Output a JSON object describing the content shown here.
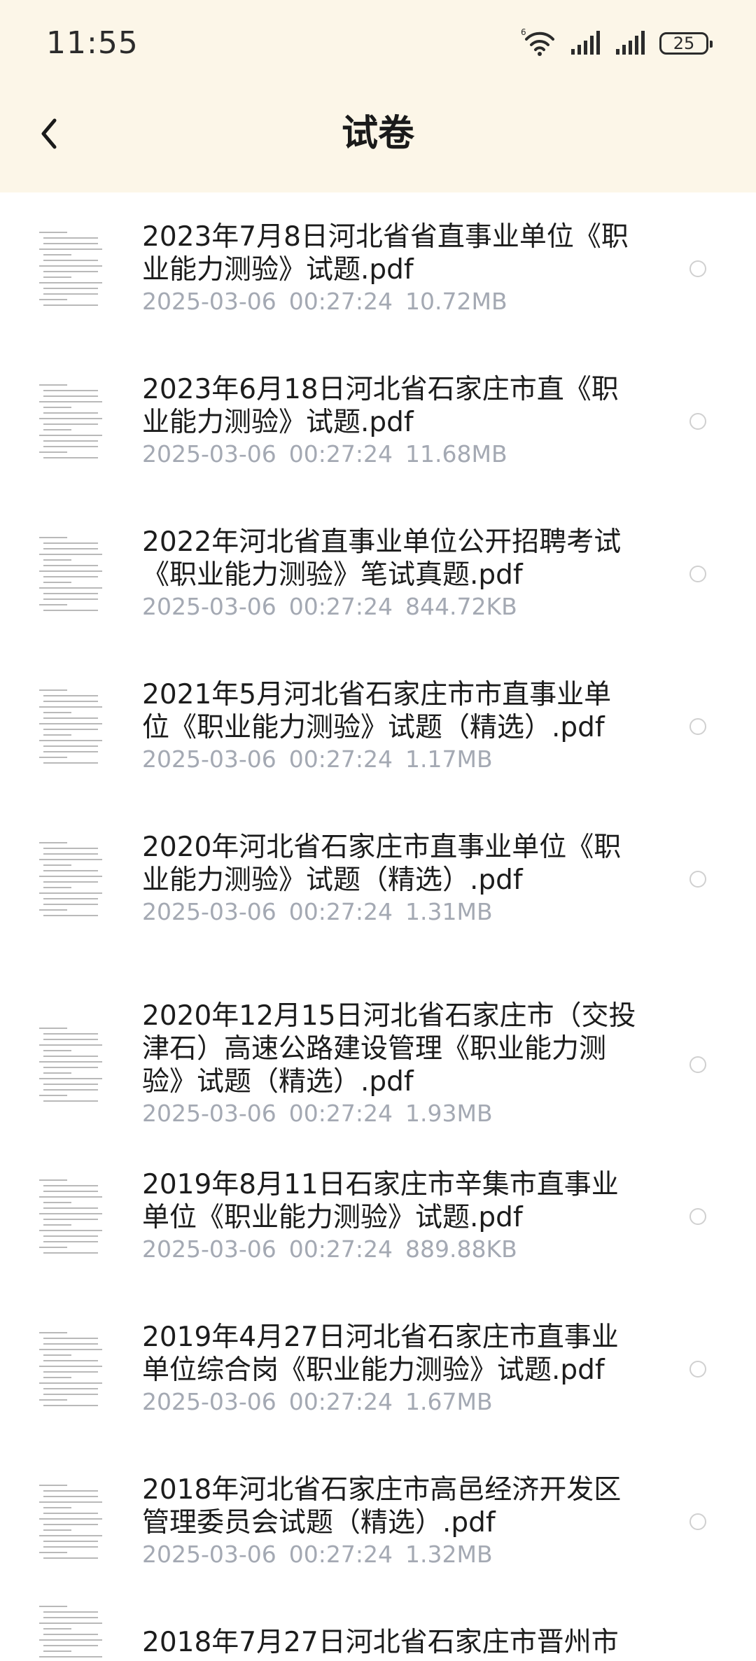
{
  "status_bar": {
    "time": "11:55",
    "wifi_icon": "wifi-6-icon",
    "signal_icons": [
      "signal-icon",
      "signal-icon"
    ],
    "battery": "25"
  },
  "header": {
    "back_icon": "chevron-left-icon",
    "title": "试卷"
  },
  "files": [
    {
      "name": "2023年7月8日河北省省直事业单位《职\n业能力测验》试题.pdf",
      "date": "2025-03-06",
      "time": "00:27:24",
      "size": "10.72MB"
    },
    {
      "name": "2023年6月18日河北省石家庄市直《职\n业能力测验》试题.pdf",
      "date": "2025-03-06",
      "time": "00:27:24",
      "size": "11.68MB"
    },
    {
      "name": "2022年河北省直事业单位公开招聘考试\n《职业能力测验》笔试真题.pdf",
      "date": "2025-03-06",
      "time": "00:27:24",
      "size": "844.72KB"
    },
    {
      "name": "2021年5月河北省石家庄市市直事业单\n位《职业能力测验》试题（精选）.pdf",
      "date": "2025-03-06",
      "time": "00:27:24",
      "size": "1.17MB"
    },
    {
      "name": "2020年河北省石家庄市直事业单位《职\n业能力测验》试题（精选）.pdf",
      "date": "2025-03-06",
      "time": "00:27:24",
      "size": "1.31MB"
    },
    {
      "name": "2020年12月15日河北省石家庄市（交投\n津石）高速公路建设管理《职业能力测\n验》试题（精选）.pdf",
      "date": "2025-03-06",
      "time": "00:27:24",
      "size": "1.93MB"
    },
    {
      "name": "2019年8月11日石家庄市辛集市直事业\n单位《职业能力测验》试题.pdf",
      "date": "2025-03-06",
      "time": "00:27:24",
      "size": "889.88KB"
    },
    {
      "name": "2019年4月27日河北省石家庄市直事业\n单位综合岗《职业能力测验》试题.pdf",
      "date": "2025-03-06",
      "time": "00:27:24",
      "size": "1.67MB"
    },
    {
      "name": "2018年河北省石家庄市高邑经济开发区\n管理委员会试题（精选）.pdf",
      "date": "2025-03-06",
      "time": "00:27:24",
      "size": "1.32MB"
    },
    {
      "name": "2018年7月27日河北省石家庄市晋州市",
      "date": "",
      "time": "",
      "size": ""
    }
  ]
}
